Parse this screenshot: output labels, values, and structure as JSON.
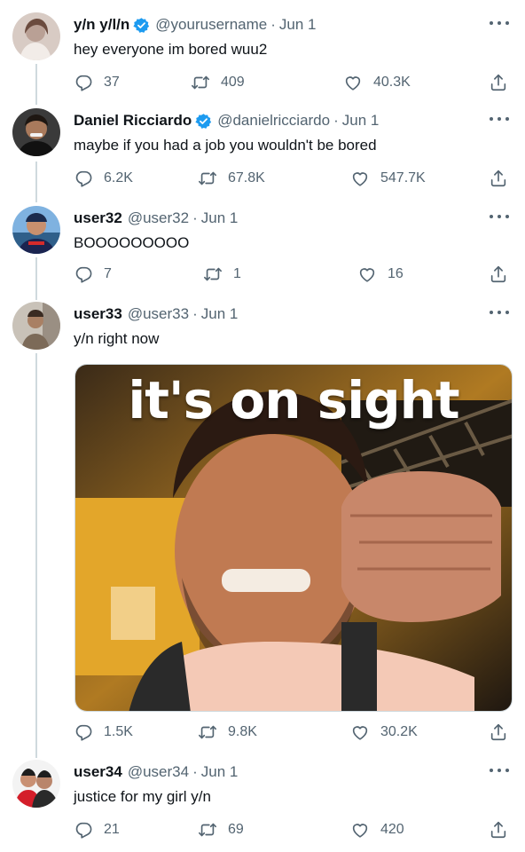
{
  "tweets": [
    {
      "name": "y/n y/l/n",
      "handle": "@yourusername",
      "dot": "·",
      "date": "Jun 1",
      "text": "hey everyone im bored wuu2",
      "replies": "37",
      "retweets": "409",
      "likes": "40.3K",
      "verified": true
    },
    {
      "name": "Daniel Ricciardo",
      "handle": "@danielricciardo",
      "dot": "·",
      "date": "Jun 1",
      "text": "maybe if you had a job you wouldn't be bored",
      "replies": "6.2K",
      "retweets": "67.8K",
      "likes": "547.7K",
      "verified": true
    },
    {
      "name": "user32",
      "handle": "@user32",
      "dot": "·",
      "date": "Jun 1",
      "text": "BOOOOOOOOO",
      "replies": "7",
      "retweets": "1",
      "likes": "16",
      "verified": false
    },
    {
      "name": "user33",
      "handle": "@user33",
      "dot": "·",
      "date": "Jun 1",
      "text": "y/n right now",
      "media_caption": "it's on sight",
      "replies": "1.5K",
      "retweets": "9.8K",
      "likes": "30.2K",
      "verified": false
    },
    {
      "name": "user34",
      "handle": "@user34",
      "dot": "·",
      "date": "Jun 1",
      "text": "justice for my girl y/n",
      "replies": "21",
      "retweets": "69",
      "likes": "420",
      "verified": false
    }
  ],
  "icons": {
    "reply": "reply-icon",
    "retweet": "retweet-icon",
    "like": "like-icon",
    "share": "share-icon",
    "more": "more-options-icon",
    "verified": "verified-badge-icon"
  },
  "colors": {
    "text": "#0f1419",
    "secondary": "#536471",
    "verified": "#1d9bf0",
    "thread_line": "#cfd9de"
  }
}
